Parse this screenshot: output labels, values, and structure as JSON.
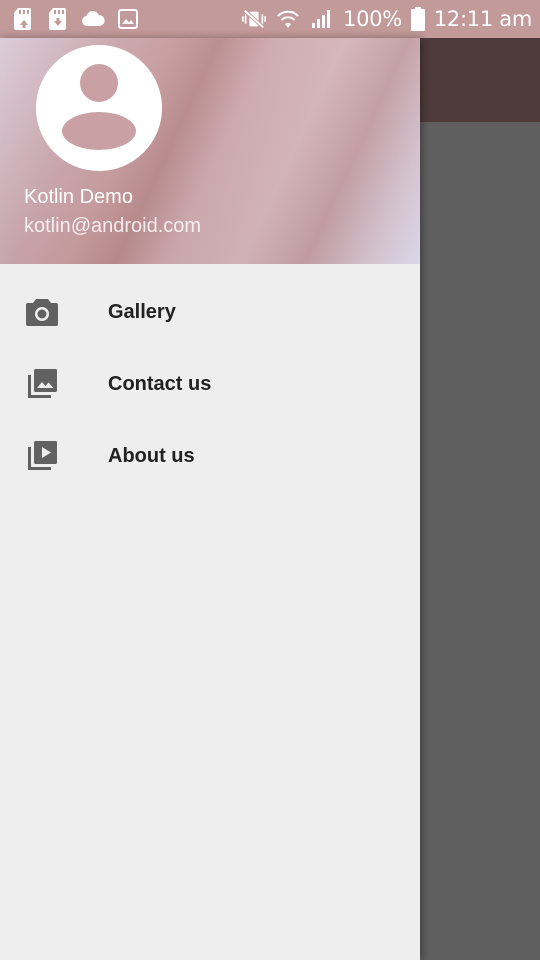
{
  "status_bar": {
    "left_icons": [
      "sd-card-upload-icon",
      "sd-card-sync-icon",
      "cloud-icon",
      "image-icon"
    ],
    "right_icons": [
      "vibrate-mute-icon",
      "wifi-icon",
      "signal-icon",
      "battery-icon"
    ],
    "battery_text": "100%",
    "time_text": "12:11 am"
  },
  "drawer": {
    "header": {
      "avatar_icon": "account-circle-icon",
      "user_name": "Kotlin Demo",
      "user_email": "kotlin@android.com"
    },
    "menu": [
      {
        "icon": "camera-icon",
        "label": "Gallery"
      },
      {
        "icon": "photo-library-icon",
        "label": "Contact us"
      },
      {
        "icon": "video-library-icon",
        "label": "About us"
      }
    ]
  },
  "colors": {
    "status_bar": "#c39a9a",
    "drawer_background": "#eeeeee",
    "scrim_background": "#5f5f5f",
    "toolbar_behind_scrim": "#4e3c3c",
    "menu_icon": "#616161",
    "menu_text": "#222222"
  }
}
